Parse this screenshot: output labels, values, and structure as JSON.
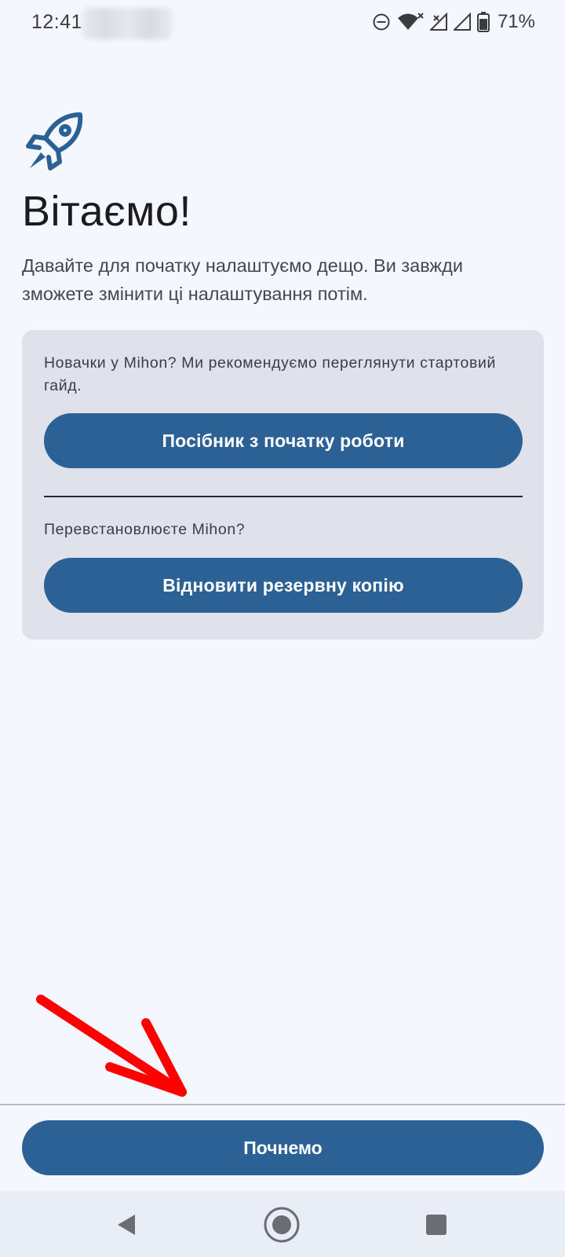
{
  "status_bar": {
    "time": "12:41",
    "battery_percent": "71%",
    "icons": [
      "do-not-disturb-icon",
      "wifi-icon",
      "signal-no-service-icon",
      "signal-icon",
      "battery-icon"
    ]
  },
  "welcome": {
    "icon": "rocket-icon",
    "title": "Вітаємо!",
    "subtitle": "Давайте для початку налаштуємо дещо. Ви завжди зможете змінити ці налаштування потім."
  },
  "card": {
    "newcomer_text": "Новачки у Mihon? Ми рекомендуємо переглянути стартовий гайд.",
    "guide_button": "Посібник з початку роботи",
    "reinstall_text": "Перевстановлюєте Mihon?",
    "restore_button": "Відновити резервну копію"
  },
  "footer": {
    "start_button": "Почнемо"
  },
  "nav_bar": {
    "icons": [
      "back-icon",
      "home-icon",
      "recents-icon"
    ]
  },
  "colors": {
    "background": "#f4f8fe",
    "primary": "#2c6195",
    "card": "#dfe2eb",
    "annotation": "#ff0000"
  }
}
